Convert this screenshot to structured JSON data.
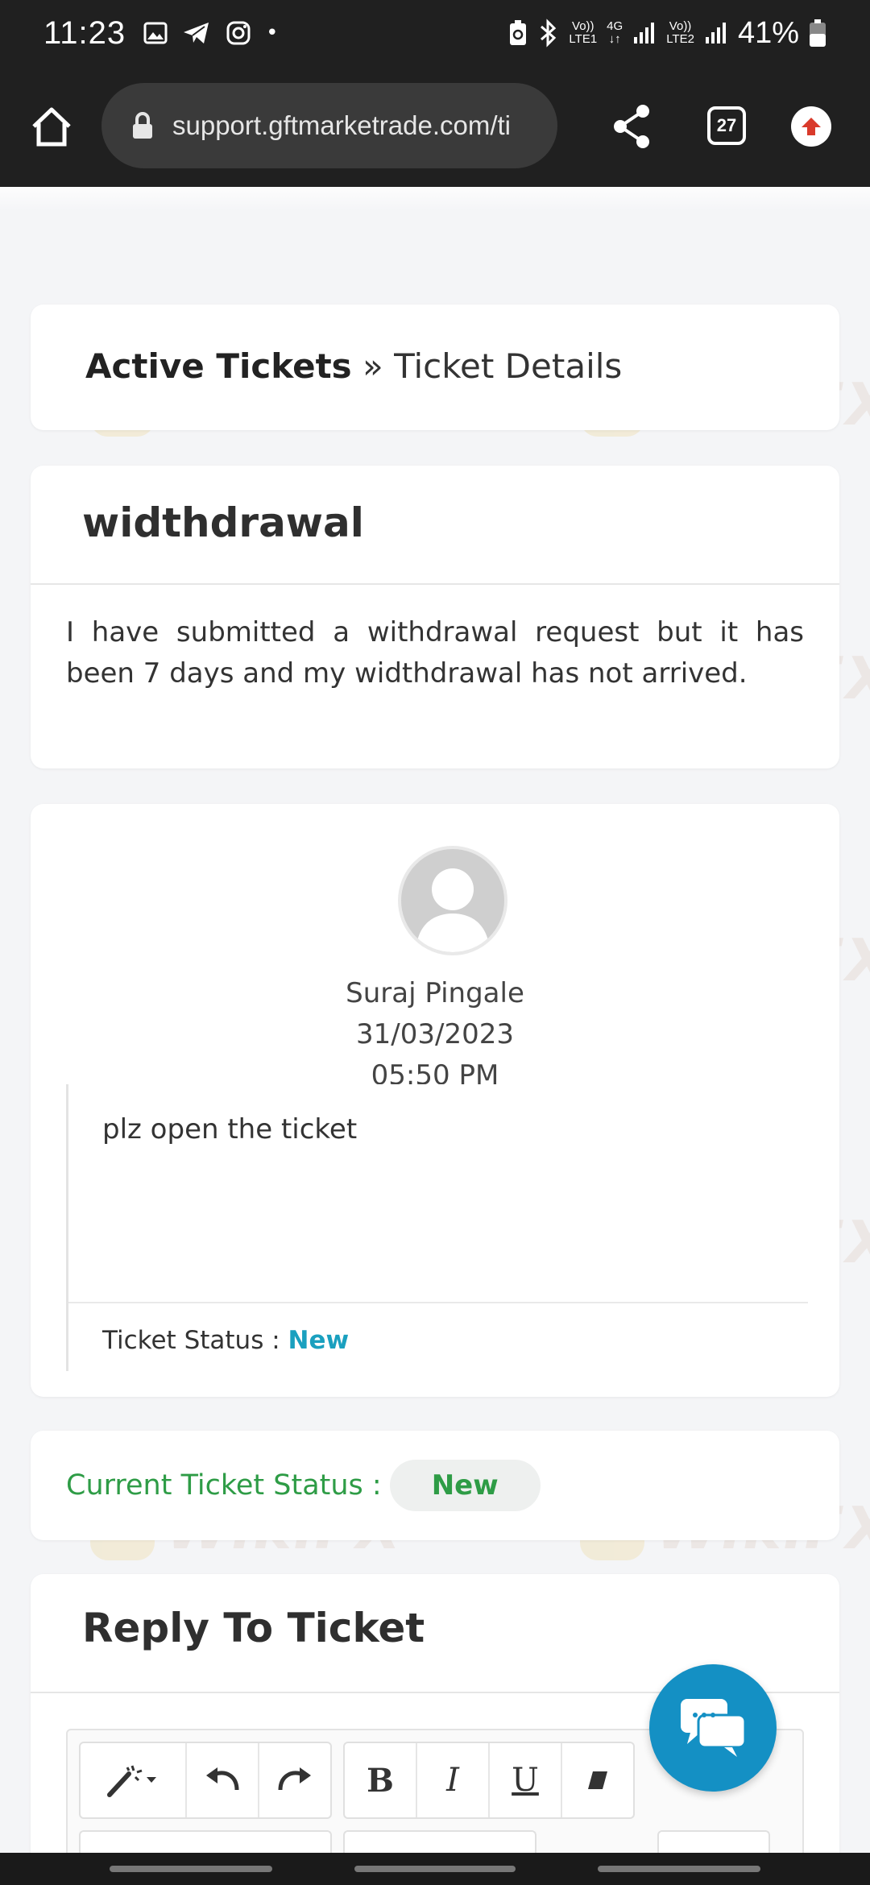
{
  "status_bar": {
    "time": "11:23",
    "battery_percent": "41%",
    "net1_top": "Vo))",
    "net1_bottom": "LTE1",
    "net_4g": "4G",
    "net2_top": "Vo))",
    "net2_bottom": "LTE2",
    "dot": "•"
  },
  "browser": {
    "url": "support.gftmarketrade.com/ti",
    "tab_count": "27"
  },
  "breadcrumb": {
    "parent": "Active Tickets",
    "separator": " » ",
    "current": "Ticket Details"
  },
  "ticket": {
    "subject": "widthdrawal",
    "description": "I have submitted a withdrawal request but it has been 7 days and my widthdrawal has not arrived."
  },
  "reply": {
    "author": "Suraj Pingale",
    "date": "31/03/2023",
    "time": "05:50 PM",
    "message": "plz open the ticket",
    "status_label": "Ticket Status : ",
    "status_value": "New"
  },
  "current_status": {
    "label": "Current Ticket Status : ",
    "value": "New"
  },
  "reply_section": {
    "title": "Reply To Ticket"
  },
  "editor_toolbar": {
    "bold": "B",
    "italic": "I",
    "underline": "U"
  },
  "watermark_text": "WikiFX",
  "colors": {
    "status_new_teal": "#1aa0bf",
    "status_green": "#2e9c46",
    "chat_fab": "#1490c4"
  }
}
